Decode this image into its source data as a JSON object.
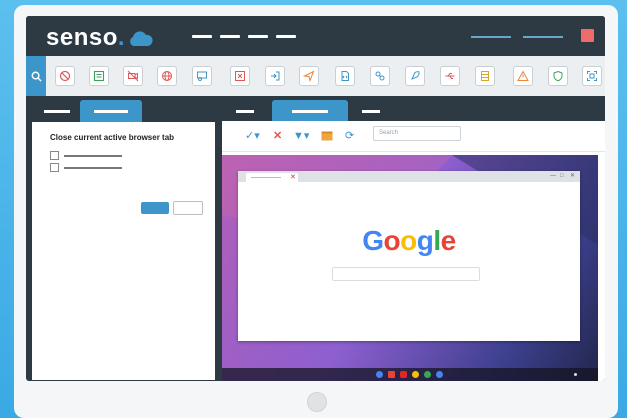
{
  "app": {
    "logo_text": "senso",
    "logo_dot_color": "#3d96ca"
  },
  "toolbar": {
    "search_icon": "search-icon",
    "tools": [
      "block-icon",
      "checklist-icon",
      "no-video-icon",
      "globe-icon",
      "screen-user-icon",
      "close-window-icon",
      "login-icon",
      "send-icon",
      "file-code-icon",
      "network-icon",
      "rocket-icon",
      "usb-icon",
      "database-icon",
      "warning-icon",
      "shield-icon",
      "scan-icon"
    ]
  },
  "task_panel": {
    "title": "Close current active browser tab"
  },
  "activity_panel": {
    "search_placeholder": "Search"
  },
  "browser": {
    "logo_text": "Google"
  },
  "colors": {
    "accent": "#3d96ca",
    "dark": "#2d3943",
    "close": "#f26b6b"
  }
}
